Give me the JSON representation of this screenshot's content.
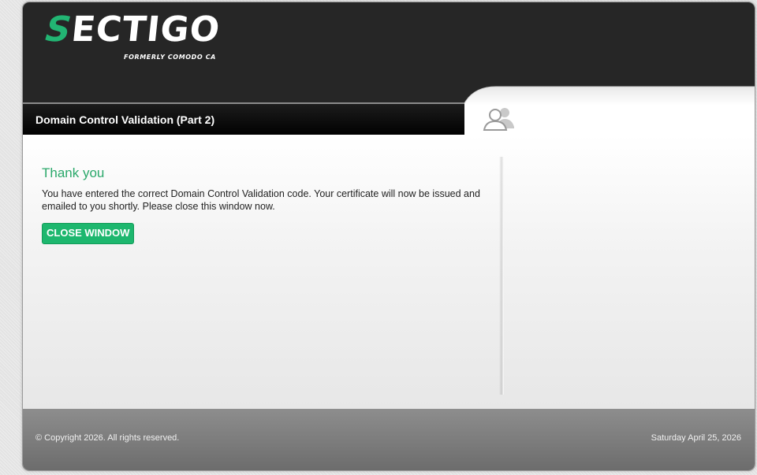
{
  "brand": {
    "logo_text_s": "S",
    "logo_text_rest": "ECTIGO",
    "logo_subtext": "FORMERLY COMODO CA",
    "accent_color": "#22b573"
  },
  "header": {
    "page_title": "Domain Control Validation (Part 2)",
    "user_icon": "users-icon"
  },
  "main": {
    "heading": "Thank you",
    "message": "You have entered the correct Domain Control Validation code. Your certificate will now be issued and emailed to you shortly. Please close this window now.",
    "close_button_label": "CLOSE WINDOW",
    "button_color": "#1db76e"
  },
  "footer": {
    "copyright": "© Copyright 2026. All rights reserved.",
    "date": "Saturday April 25, 2026"
  }
}
